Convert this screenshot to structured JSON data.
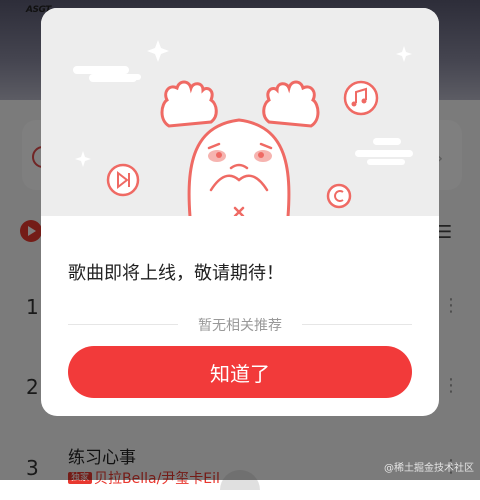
{
  "background": {
    "brand_logo_text": "ASGT",
    "banner_text": "………",
    "rows": [
      {
        "number": "1"
      },
      {
        "number": "2"
      },
      {
        "number": "3",
        "title": "练习心事",
        "badge": "独家",
        "artist": "贝拉Bella/尹玺卡Eil"
      }
    ]
  },
  "modal": {
    "message": "歌曲即将上线，敬请期待！",
    "no_recommend_label": "暂无相关推荐",
    "confirm_label": "知道了",
    "icons": [
      "music-note-icon",
      "skip-icon",
      "copyright-icon",
      "sparkle-icon",
      "cloud-icon"
    ]
  },
  "watermark": "@稀土掘金技术社区",
  "colors": {
    "accent": "#f23a3a",
    "illustration_bg": "#ededed",
    "mascot_stroke": "#ef6a64"
  }
}
